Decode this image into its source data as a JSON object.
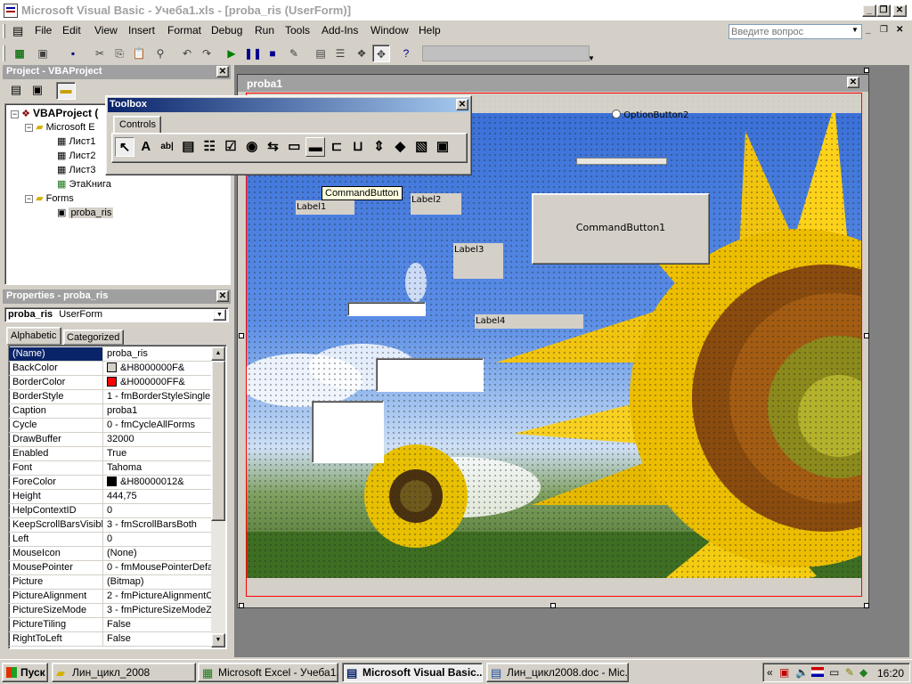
{
  "window": {
    "title": "Microsoft Visual Basic - Учеба1.xls - [proba_ris (UserForm)]"
  },
  "menu": [
    "File",
    "Edit",
    "View",
    "Insert",
    "Format",
    "Debug",
    "Run",
    "Tools",
    "Add-Ins",
    "Window",
    "Help"
  ],
  "search": {
    "placeholder": "Введите вопрос"
  },
  "project": {
    "title": "Project - VBAProject",
    "root": "VBAProject (",
    "folder1": "Microsoft E",
    "sheets": [
      "Лист1",
      "Лист2",
      "Лист3",
      "ЭтаКнига"
    ],
    "folder2": "Forms",
    "form": "proba_ris"
  },
  "properties": {
    "title": "Properties - proba_ris",
    "object_name": "proba_ris",
    "object_type": "UserForm",
    "tabs": [
      "Alphabetic",
      "Categorized"
    ],
    "rows": [
      {
        "name": "(Name)",
        "value": "proba_ris"
      },
      {
        "name": "BackColor",
        "value": "&H8000000F&",
        "swatch": "#d4d0c8"
      },
      {
        "name": "BorderColor",
        "value": "&H000000FF&",
        "swatch": "#ff0000"
      },
      {
        "name": "BorderStyle",
        "value": "1 - fmBorderStyleSingle"
      },
      {
        "name": "Caption",
        "value": "proba1"
      },
      {
        "name": "Cycle",
        "value": "0 - fmCycleAllForms"
      },
      {
        "name": "DrawBuffer",
        "value": "32000"
      },
      {
        "name": "Enabled",
        "value": "True"
      },
      {
        "name": "Font",
        "value": "Tahoma"
      },
      {
        "name": "ForeColor",
        "value": "&H80000012&",
        "swatch": "#000000"
      },
      {
        "name": "Height",
        "value": "444,75"
      },
      {
        "name": "HelpContextID",
        "value": "0"
      },
      {
        "name": "KeepScrollBarsVisible",
        "value": "3 - fmScrollBarsBoth"
      },
      {
        "name": "Left",
        "value": "0"
      },
      {
        "name": "MouseIcon",
        "value": "(None)"
      },
      {
        "name": "MousePointer",
        "value": "0 - fmMousePointerDefau"
      },
      {
        "name": "Picture",
        "value": "(Bitmap)"
      },
      {
        "name": "PictureAlignment",
        "value": "2 - fmPictureAlignmentCe"
      },
      {
        "name": "PictureSizeMode",
        "value": "3 - fmPictureSizeModeZo"
      },
      {
        "name": "PictureTiling",
        "value": "False"
      },
      {
        "name": "RightToLeft",
        "value": "False"
      }
    ]
  },
  "toolbox": {
    "title": "Toolbox",
    "tab": "Controls",
    "tooltip": "CommandButton"
  },
  "form": {
    "window_title": "proba1",
    "option_button": "OptionButton2",
    "label1": "Label1",
    "label2": "Label2",
    "label3": "Label3",
    "label4": "Label4",
    "command_button": "CommandButton1"
  },
  "taskbar": {
    "start": "Пуск",
    "tasks": [
      "Лин_цикл_2008",
      "Microsoft Excel - Учеба1...",
      "Microsoft Visual Basic...",
      "Лин_цикл2008.doc - Mic..."
    ],
    "clock": "16:20"
  },
  "colors": {
    "title_active": "#0a246a",
    "title_inactive": "#a0a0a0",
    "selection": "#0a246a",
    "form_border": "#ff0000"
  }
}
